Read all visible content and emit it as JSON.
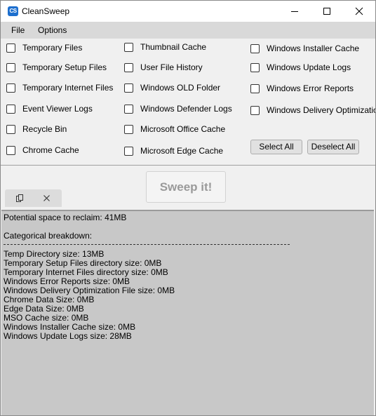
{
  "app": {
    "title": "CleanSweep",
    "icon_text": "CS",
    "icon_color": "#1d6fce"
  },
  "menu": [
    "File",
    "Options"
  ],
  "options": {
    "col1": [
      "Temporary Files",
      "Temporary Setup Files",
      "Temporary Internet Files",
      "Event Viewer Logs",
      "Recycle Bin",
      "Chrome Cache"
    ],
    "col2": [
      "Thumbnail Cache",
      "User File History",
      "Windows OLD Folder",
      "Windows Defender Logs",
      "Microsoft Office Cache",
      "Microsoft Edge Cache"
    ],
    "col3": [
      "Windows Installer Cache",
      "Windows Update Logs",
      "Windows Error Reports",
      "Windows Delivery Optimization"
    ]
  },
  "buttons": {
    "select_all": "Select All",
    "deselect_all": "Deselect All",
    "sweep": "Sweep it!"
  },
  "output": {
    "potential": "Potential space to reclaim: 41MB",
    "heading": "Categorical breakdown:",
    "lines": [
      "Temp Directory size: 13MB",
      "Temporary Setup Files directory size: 0MB",
      "Temporary Internet Files directory size: 0MB",
      "Windows Error Reports size: 0MB",
      "Windows Delivery Optimization File size: 0MB",
      "Chrome Data Size: 0MB",
      "Edge Data Size: 0MB",
      "MSO Cache size: 0MB",
      "Windows Installer Cache size: 0MB",
      "Windows Update Logs size: 28MB"
    ]
  }
}
